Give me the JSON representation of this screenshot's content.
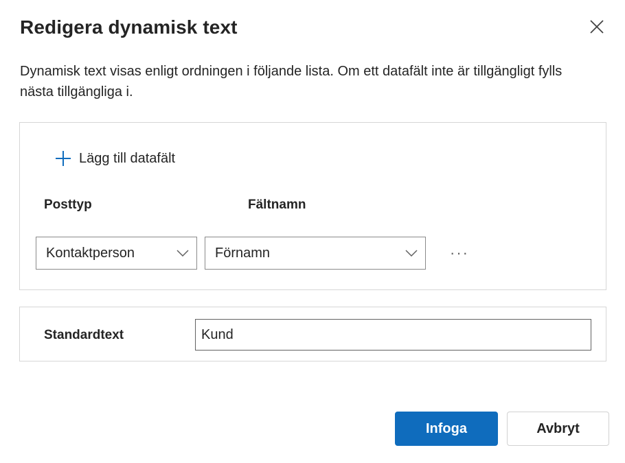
{
  "dialog": {
    "title": "Redigera dynamisk text",
    "description": "Dynamisk text visas enligt ordningen i följande lista. Om ett datafält inte är tillgängligt fylls nästa tillgängliga i.",
    "close_icon": "close-icon"
  },
  "fields_panel": {
    "add_field_label": "Lägg till datafält",
    "add_icon": "plus-icon",
    "columns": {
      "record_type": "Posttyp",
      "field_name": "Fältnamn"
    },
    "rows": [
      {
        "record_type": "Kontaktperson",
        "field_name": "Förnamn",
        "more_label": "···"
      }
    ]
  },
  "default_text": {
    "label": "Standardtext",
    "value": "Kund"
  },
  "footer": {
    "insert_label": "Infoga",
    "cancel_label": "Avbryt"
  },
  "colors": {
    "primary": "#0f6cbd",
    "accent_icon": "#0f6cbd",
    "text": "#242424",
    "border": "#d6d6d6"
  }
}
